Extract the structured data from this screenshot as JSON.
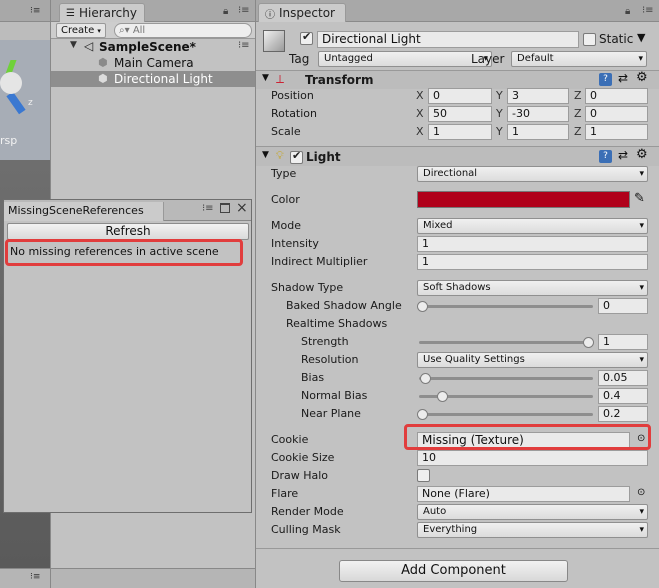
{
  "hierarchy": {
    "tab_label": "Hierarchy",
    "create_label": "Create",
    "search_placeholder": "All",
    "scene_name": "SampleScene*",
    "items": [
      "Main Camera",
      "Directional Light"
    ]
  },
  "scene_view": {
    "label": "rsp"
  },
  "missing_refs": {
    "title": "MissingSceneReferences",
    "refresh_label": "Refresh",
    "message": "No missing references in active scene"
  },
  "inspector": {
    "tab_label": "Inspector",
    "object_name": "Directional Light",
    "static_label": "Static",
    "tag_label": "Tag",
    "tag_value": "Untagged",
    "layer_label": "Layer",
    "layer_value": "Default",
    "transform": {
      "title": "Transform",
      "rows": [
        {
          "label": "Position",
          "x": "0",
          "y": "3",
          "z": "0"
        },
        {
          "label": "Rotation",
          "x": "50",
          "y": "-30",
          "z": "0"
        },
        {
          "label": "Scale",
          "x": "1",
          "y": "1",
          "z": "1"
        }
      ]
    },
    "light": {
      "title": "Light",
      "type_label": "Type",
      "type_value": "Directional",
      "color_label": "Color",
      "color_value": "#b0001a",
      "mode_label": "Mode",
      "mode_value": "Mixed",
      "intensity_label": "Intensity",
      "intensity_value": "1",
      "indirect_label": "Indirect Multiplier",
      "indirect_value": "1",
      "shadow_type_label": "Shadow Type",
      "shadow_type_value": "Soft Shadows",
      "baked_angle_label": "Baked Shadow Angle",
      "baked_angle_value": "0",
      "realtime_label": "Realtime Shadows",
      "strength_label": "Strength",
      "strength_value": "1",
      "resolution_label": "Resolution",
      "resolution_value": "Use Quality Settings",
      "bias_label": "Bias",
      "bias_value": "0.05",
      "normal_bias_label": "Normal Bias",
      "normal_bias_value": "0.4",
      "near_plane_label": "Near Plane",
      "near_plane_value": "0.2",
      "cookie_label": "Cookie",
      "cookie_value": "Missing (Texture)",
      "cookie_size_label": "Cookie Size",
      "cookie_size_value": "10",
      "draw_halo_label": "Draw Halo",
      "flare_label": "Flare",
      "flare_value": "None (Flare)",
      "render_mode_label": "Render Mode",
      "render_mode_value": "Auto",
      "culling_label": "Culling Mask",
      "culling_value": "Everything"
    },
    "add_component_label": "Add Component"
  },
  "axis_labels": {
    "x": "X",
    "y": "Y",
    "z": "Z"
  },
  "colors": {
    "highlight": "#e13d3d",
    "light_color": "#b0001a"
  }
}
